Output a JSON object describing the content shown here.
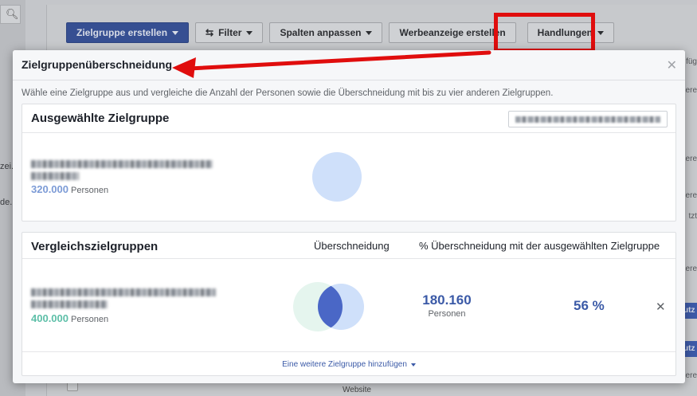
{
  "background": {
    "left_labels": [
      "zei.",
      "de.."
    ],
    "toolbar": {
      "create_audience": "Zielgruppe erstellen",
      "filter": "Filter",
      "columns": "Spalten anpassen",
      "create_ad": "Werbeanzeige erstellen",
      "actions": "Handlungen"
    },
    "right_col": [
      "füg",
      "ere",
      "ere",
      "ere",
      "tzt",
      "ere",
      "ere"
    ],
    "right_buttons": [
      "utz",
      "utz"
    ],
    "bottom_text": "Website"
  },
  "dialog": {
    "title": "Zielgruppenüberschneidung",
    "description": "Wähle eine Zielgruppe aus und vergleiche die Anzahl der Personen sowie die Überschneidung mit bis zu vier anderen Zielgruppen.",
    "selected": {
      "heading": "Ausgewählte Zielgruppe",
      "count": "320.000",
      "unit": "Personen",
      "count_color": "#7c9bd6"
    },
    "comparison": {
      "heading": "Vergleichszielgruppen",
      "col_overlap": "Überschneidung",
      "col_percent": "% Überschneidung mit der ausgewählten Zielgruppe",
      "rows": [
        {
          "count": "400.000",
          "unit": "Personen",
          "count_color": "#5dbfa8",
          "overlap_value": "180.160",
          "overlap_unit": "Personen",
          "overlap_percent": "56 %"
        }
      ],
      "add_link": "Eine weitere Zielgruppe hinzufügen"
    }
  },
  "colors": {
    "accent": "#3b5aa7",
    "highlight": "#e00d0d",
    "venn_selected": "#cfe0fa",
    "venn_compare": "#e5f5ee",
    "venn_overlap": "#4a67c6"
  }
}
